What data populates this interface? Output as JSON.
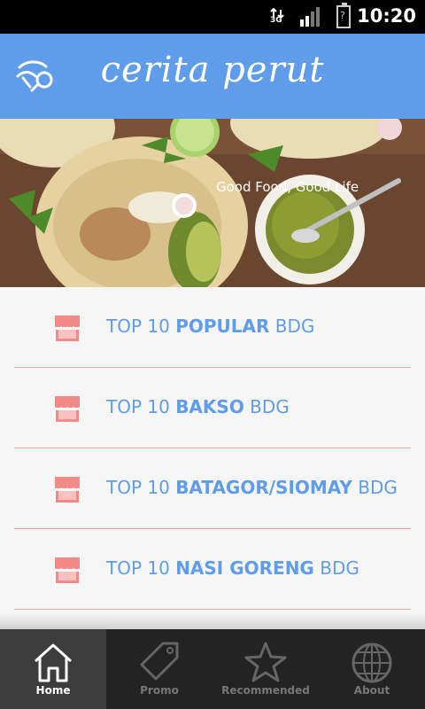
{
  "status_bar": {
    "time": "10:20",
    "network_label": "3G"
  },
  "app": {
    "title": "cerita perut"
  },
  "hero": {
    "tagline": "Good Food, Good Life"
  },
  "list": {
    "items": [
      {
        "prefix": "TOP 10 ",
        "bold": "POPULAR",
        "suffix": " BDG"
      },
      {
        "prefix": "TOP 10 ",
        "bold": "BAKSO",
        "suffix": " BDG"
      },
      {
        "prefix": "TOP 10 ",
        "bold": "BATAGOR/SIOMAY",
        "suffix": " BDG"
      },
      {
        "prefix": "TOP 10 ",
        "bold": "NASI GORENG",
        "suffix": " BDG"
      }
    ]
  },
  "tabs": [
    {
      "label": "Home",
      "icon": "home-icon",
      "active": true
    },
    {
      "label": "Promo",
      "icon": "tag-icon",
      "active": false
    },
    {
      "label": "Recommended",
      "icon": "star-icon",
      "active": false
    },
    {
      "label": "About",
      "icon": "globe-icon",
      "active": false
    }
  ],
  "colors": {
    "accent": "#5f9dea",
    "store_icon": "#f28b87",
    "divider": "#e7a8a0",
    "tab_bar": "#232323"
  }
}
